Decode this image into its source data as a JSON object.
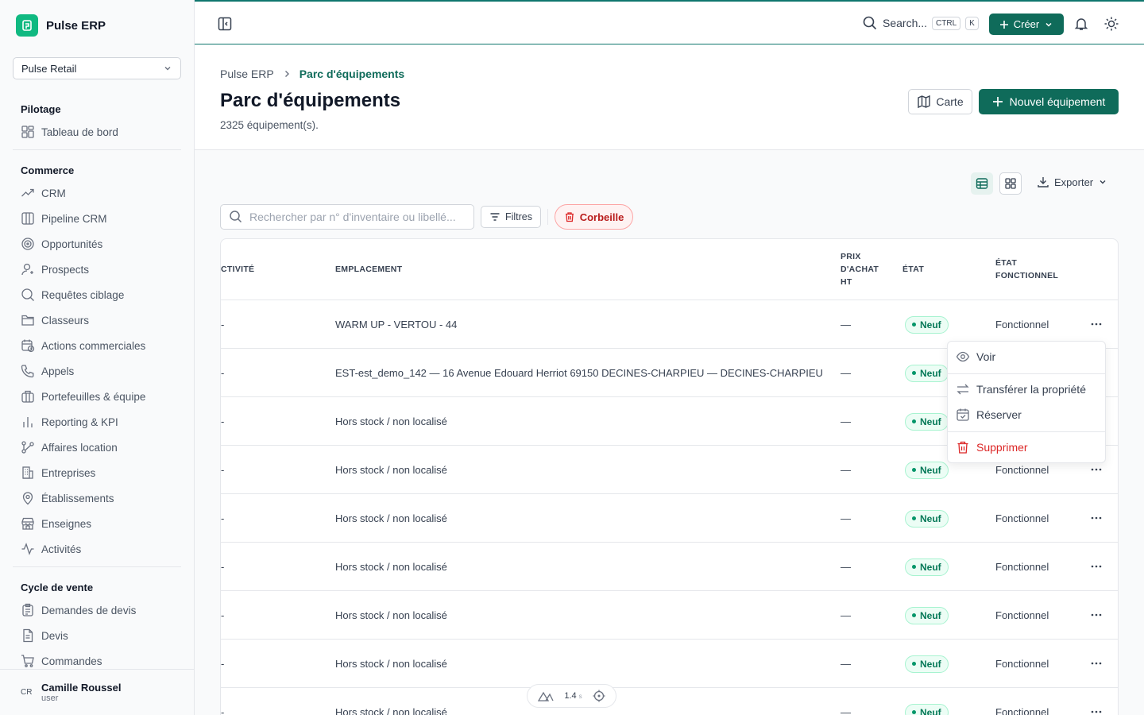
{
  "app": {
    "name": "Pulse ERP"
  },
  "company_selector": {
    "value": "Pulse Retail"
  },
  "sidebar": {
    "sections": [
      {
        "title": "Pilotage",
        "items": [
          {
            "label": "Tableau de bord",
            "icon": "dashboard-icon"
          }
        ]
      },
      {
        "title": "Commerce",
        "items": [
          {
            "label": "CRM",
            "icon": "trend-icon"
          },
          {
            "label": "Pipeline CRM",
            "icon": "columns-icon"
          },
          {
            "label": "Opportunités",
            "icon": "target-icon"
          },
          {
            "label": "Prospects",
            "icon": "user-icon"
          },
          {
            "label": "Requêtes ciblage",
            "icon": "search-icon"
          },
          {
            "label": "Classeurs",
            "icon": "folder-icon"
          },
          {
            "label": "Actions commerciales",
            "icon": "calendar-clock-icon"
          },
          {
            "label": "Appels",
            "icon": "phone-icon"
          },
          {
            "label": "Portefeuilles & équipe",
            "icon": "briefcase-icon"
          },
          {
            "label": "Reporting & KPI",
            "icon": "bar-chart-icon"
          },
          {
            "label": "Affaires location",
            "icon": "branch-icon"
          },
          {
            "label": "Entreprises",
            "icon": "building-icon"
          },
          {
            "label": "Établissements",
            "icon": "map-pin-icon"
          },
          {
            "label": "Enseignes",
            "icon": "store-icon"
          },
          {
            "label": "Activités",
            "icon": "activity-icon"
          }
        ]
      },
      {
        "title": "Cycle de vente",
        "items": [
          {
            "label": "Demandes de devis",
            "icon": "clipboard-icon"
          },
          {
            "label": "Devis",
            "icon": "file-icon"
          },
          {
            "label": "Commandes",
            "icon": "cart-icon"
          }
        ]
      }
    ]
  },
  "user": {
    "initials": "CR",
    "name": "Camille Roussel",
    "role": "user"
  },
  "topbar": {
    "search_label": "Search...",
    "kbd_ctrl": "CTRL",
    "kbd_k": "K",
    "create_label": "Créer"
  },
  "breadcrumb": {
    "root": "Pulse ERP",
    "current": "Parc d'équipements"
  },
  "page": {
    "title": "Parc d'équipements",
    "subtitle": "2325 équipement(s).",
    "map_label": "Carte",
    "new_label": "Nouvel équipement"
  },
  "toolbar": {
    "export_label": "Exporter",
    "search_placeholder": "Rechercher par n° d'inventaire ou libellé...",
    "filters_label": "Filtres",
    "trash_label": "Corbeille"
  },
  "table": {
    "columns": {
      "activity": "CTIVITÉ",
      "location": "EMPLACEMENT",
      "price_1": "PRIX",
      "price_2": "D'ACHAT",
      "price_3": "HT",
      "state": "ÉTAT",
      "func_1": "ÉTAT",
      "func_2": "FONCTIONNEL"
    },
    "rows": [
      {
        "activity": "-",
        "location": "WARM UP - VERTOU - 44",
        "price": "—",
        "state": "Neuf",
        "functional": "Fonctionnel"
      },
      {
        "activity": "-",
        "location": "EST-est_demo_142 — 16 Avenue Edouard Herriot 69150 DECINES-CHARPIEU — DECINES-CHARPIEU",
        "price": "—",
        "state": "Neuf",
        "functional": ""
      },
      {
        "activity": "-",
        "location": "Hors stock / non localisé",
        "price": "—",
        "state": "Neuf",
        "functional": ""
      },
      {
        "activity": "-",
        "location": "Hors stock / non localisé",
        "price": "—",
        "state": "Neuf",
        "functional": "Fonctionnel"
      },
      {
        "activity": "-",
        "location": "Hors stock / non localisé",
        "price": "—",
        "state": "Neuf",
        "functional": "Fonctionnel"
      },
      {
        "activity": "-",
        "location": "Hors stock / non localisé",
        "price": "—",
        "state": "Neuf",
        "functional": "Fonctionnel"
      },
      {
        "activity": "-",
        "location": "Hors stock / non localisé",
        "price": "—",
        "state": "Neuf",
        "functional": "Fonctionnel"
      },
      {
        "activity": "-",
        "location": "Hors stock / non localisé",
        "price": "—",
        "state": "Neuf",
        "functional": "Fonctionnel"
      },
      {
        "activity": "-",
        "location": "Hors stock / non localisé",
        "price": "—",
        "state": "Neuf",
        "functional": "Fonctionnel"
      }
    ]
  },
  "row_menu": {
    "view": "Voir",
    "transfer": "Transférer la propriété",
    "reserve": "Réserver",
    "delete": "Supprimer"
  },
  "devtools": {
    "timing": "1.4",
    "unit": "s"
  },
  "colors": {
    "primary": "#0f6b5a",
    "danger": "#dc2626",
    "badge_green": "#047857"
  }
}
